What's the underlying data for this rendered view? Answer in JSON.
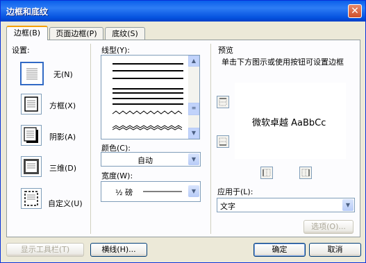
{
  "window": {
    "title": "边框和底纹",
    "close_glyph": "✕"
  },
  "tabs": [
    {
      "label": "边框(B)",
      "active": true
    },
    {
      "label": "页面边框(P)",
      "active": false
    },
    {
      "label": "底纹(S)",
      "active": false
    }
  ],
  "settings": {
    "heading": "设置:",
    "items": [
      {
        "label": "无(N)",
        "selected": true
      },
      {
        "label": "方框(X)",
        "selected": false
      },
      {
        "label": "阴影(A)",
        "selected": false
      },
      {
        "label": "三维(D)",
        "selected": false
      },
      {
        "label": "自定义(U)",
        "selected": false
      }
    ]
  },
  "style": {
    "heading": "线型(Y):",
    "color_label": "颜色(C):",
    "color_value": "自动",
    "width_label": "宽度(W):",
    "width_value": "½ 磅"
  },
  "preview": {
    "heading": "预览",
    "hint": "单击下方图示或使用按钮可设置边框",
    "sample_text": "微软卓越  AaBbCc",
    "apply_label": "应用于(L):",
    "apply_value": "文字",
    "options_button": "选项(O)..."
  },
  "footer": {
    "toolbar_button": "显示工具栏(T)",
    "hline_button": "横线(H)...",
    "ok_button": "确定",
    "cancel_button": "取消"
  },
  "colors": {
    "titlebar": "#0a5fea",
    "dialog_bg": "#ece9d8",
    "accent_tab": "#f5a000"
  }
}
